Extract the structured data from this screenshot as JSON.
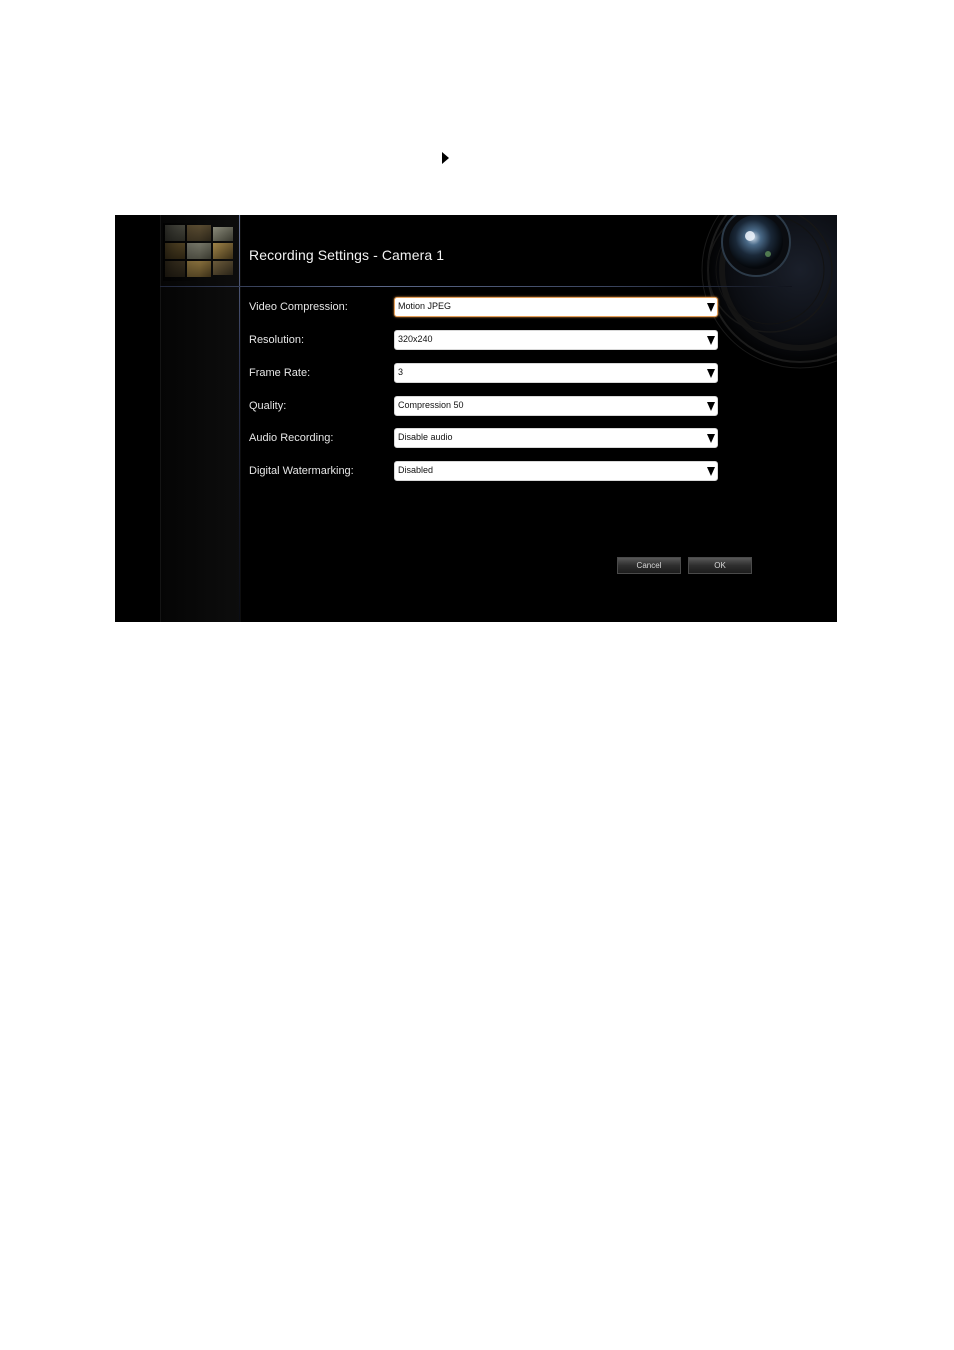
{
  "pointer": {
    "icon": "triangle-pointer-icon"
  },
  "dialog": {
    "title": "Recording Settings - Camera 1",
    "thumbnails_icon": "video-thumbnails-icon",
    "lens_icon": "camera-lens-icon",
    "rows": [
      {
        "label": "Video Compression:",
        "value": "Motion JPEG",
        "focused": true
      },
      {
        "label": "Resolution:",
        "value": "320x240",
        "focused": false
      },
      {
        "label": "Frame Rate:",
        "value": "3",
        "focused": false
      },
      {
        "label": "Quality:",
        "value": "Compression 50",
        "focused": false
      },
      {
        "label": "Audio Recording:",
        "value": "Disable audio",
        "focused": false
      },
      {
        "label": "Digital Watermarking:",
        "value": "Disabled",
        "focused": false
      }
    ],
    "buttons": {
      "cancel": "Cancel",
      "ok": "OK"
    }
  },
  "colors": {
    "dialog_background": "#000000",
    "focus_border": "#e5a05a",
    "accent_line": "#5a6788"
  }
}
